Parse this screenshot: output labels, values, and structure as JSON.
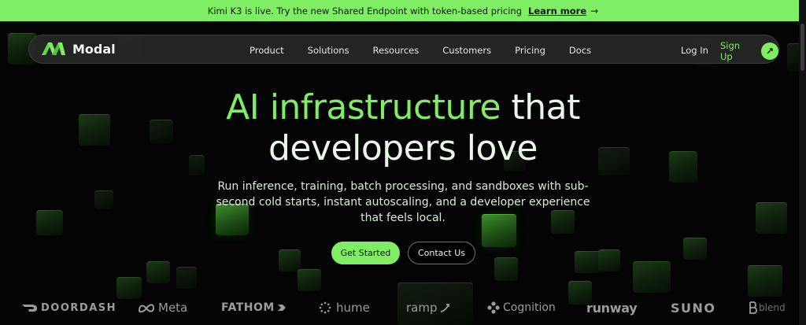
{
  "announcement": {
    "message": "Kimi K3 is live. Try the new Shared Endpoint with token-based pricing",
    "link_label": "Learn more",
    "icon": "arrow-right-icon"
  },
  "nav": {
    "brand": "Modal",
    "links": [
      "Product",
      "Solutions",
      "Resources",
      "Customers",
      "Pricing",
      "Docs"
    ],
    "login_label": "Log In",
    "signup_label": "Sign Up",
    "signup_icon": "arrow-up-right-icon"
  },
  "hero": {
    "title_accent": "AI infrastructure",
    "title_rest_1": " that",
    "title_line2": "developers love",
    "subtitle": "Run inference, training, batch processing, and sandboxes with sub-second cold starts, instant autoscaling, and a developer experience that feels local.",
    "primary_cta": "Get Started",
    "secondary_cta": "Contact Us"
  },
  "logos": [
    "DOORDASH",
    "Meta",
    "FATHOM",
    "hume",
    "ramp",
    "Cognition",
    "runway",
    "SUNO",
    "blend"
  ],
  "colors": {
    "accent": "#7fee64",
    "background": "#030403",
    "nav_bg": "#262826"
  }
}
